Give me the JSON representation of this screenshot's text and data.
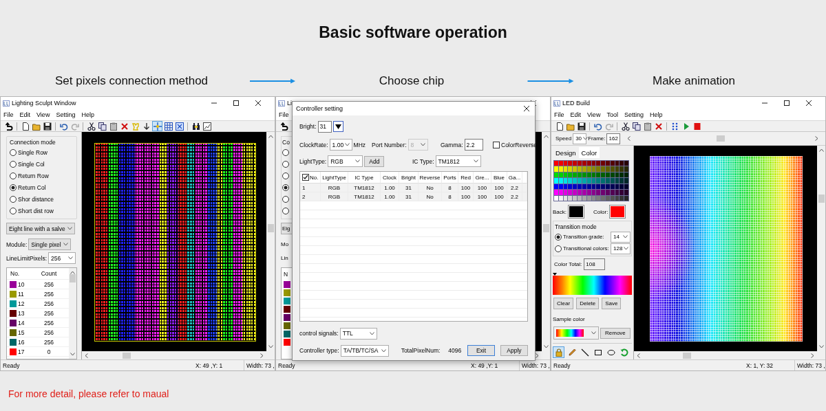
{
  "title": "Basic software operation",
  "steps": [
    {
      "label": "Set pixels connection method"
    },
    {
      "label": "Choose chip"
    },
    {
      "label": "Make animation"
    }
  ],
  "sculpt_window": {
    "title": "Lighting Sculpt Window",
    "menu": [
      "File",
      "Edit",
      "View",
      "Setting",
      "Help"
    ],
    "toolbar": [
      [
        {
          "kind": "back",
          "selected": false
        }
      ],
      [
        {
          "kind": "new",
          "selected": false
        },
        {
          "kind": "open",
          "selected": false
        },
        {
          "kind": "save",
          "selected": false
        }
      ],
      [
        {
          "kind": "undo",
          "selected": false
        },
        {
          "kind": "redo",
          "selected": false
        }
      ],
      [
        {
          "kind": "cut",
          "selected": false
        },
        {
          "kind": "copy",
          "selected": false
        },
        {
          "kind": "paste",
          "selected": false
        },
        {
          "kind": "delete",
          "selected": false
        },
        {
          "kind": "shape",
          "selected": false
        },
        {
          "kind": "down",
          "selected": false
        },
        {
          "kind": "cross",
          "selected": true
        },
        {
          "kind": "grid",
          "selected": false
        },
        {
          "kind": "gridx",
          "selected": false
        }
      ],
      [
        {
          "kind": "find",
          "selected": false
        },
        {
          "kind": "image",
          "selected": false
        }
      ]
    ],
    "connection_mode": {
      "title": "Connection mode",
      "options": [
        {
          "label": "Single Row",
          "selected": false
        },
        {
          "label": "Single Col",
          "selected": false
        },
        {
          "label": "Return Row",
          "selected": false
        },
        {
          "label": "Return Col",
          "selected": true
        },
        {
          "label": "Shor distance",
          "selected": false
        },
        {
          "label": "Short dist row",
          "selected": false
        }
      ]
    },
    "wiring": "Eight line with a salve",
    "module": {
      "label": "Module:",
      "value": "Single pixel"
    },
    "line_limit": {
      "label": "LineLimitPixels:",
      "value": "256"
    },
    "port_list": {
      "columns": [
        "No.",
        "Count"
      ],
      "rows": [
        {
          "no": "10",
          "count": "256",
          "color": "#990099"
        },
        {
          "no": "11",
          "count": "256",
          "color": "#999900"
        },
        {
          "no": "12",
          "count": "256",
          "color": "#009999"
        },
        {
          "no": "13",
          "count": "256",
          "color": "#660000"
        },
        {
          "no": "14",
          "count": "256",
          "color": "#660066"
        },
        {
          "no": "15",
          "count": "256",
          "color": "#666600"
        },
        {
          "no": "16",
          "count": "256",
          "color": "#006666"
        },
        {
          "no": "17",
          "count": "0",
          "color": "#ff0000"
        }
      ]
    },
    "status_bar": {
      "text": "Ready",
      "position": "X: 49 ,Y: 1",
      "size": "Width: 73 ,"
    }
  },
  "chip_window": {
    "title": "Li",
    "menu": [
      "File"
    ],
    "toolbar": [
      [
        {
          "kind": "back",
          "selected": false
        }
      ]
    ],
    "panel": {
      "group_title": "Co",
      "radios": [
        {
          "selected": false
        },
        {
          "selected": false
        },
        {
          "selected": false
        },
        {
          "selected": true
        },
        {
          "selected": false
        },
        {
          "selected": false
        }
      ],
      "wiring": "Eig",
      "module_label": "Mo",
      "line_limit_label": "Lin",
      "list_header": "N",
      "swatches": [
        {
          "color": "#990099"
        },
        {
          "color": "#999900"
        },
        {
          "color": "#009999"
        },
        {
          "color": "#660000"
        },
        {
          "color": "#660066"
        },
        {
          "color": "#666600"
        },
        {
          "color": "#006666"
        },
        {
          "color": "#ff0000"
        }
      ]
    },
    "dialog": {
      "title": "Controller setting",
      "bright": {
        "label": "Bright:",
        "value": "31"
      },
      "clock_rate": {
        "label": "ClockRate:",
        "value": "1.00",
        "unit": "MHz"
      },
      "port_number": {
        "label": "Port Number:",
        "value": "8",
        "disabled": true
      },
      "gamma": {
        "label": "Gamma:",
        "value": "2.2"
      },
      "color_reverse": {
        "label": "ColorReverse",
        "checked": false
      },
      "light_type": {
        "label": "LightType:",
        "value": "RGB"
      },
      "add_button": "Add",
      "ic_type": {
        "label": "IC Type:",
        "value": "TM1812"
      },
      "table": {
        "header_checked": true,
        "columns": [
          "No.",
          "LightType",
          "IC Type",
          "Clock",
          "Bright",
          "Reverse",
          "Ports",
          "Red",
          "Gre...",
          "Blue",
          "Ga..."
        ],
        "rows": [
          [
            "1",
            "RGB",
            "TM1812",
            "1.00",
            "31",
            "No",
            "8",
            "100",
            "100",
            "100",
            "2.2"
          ],
          [
            "2",
            "RGB",
            "TM1812",
            "1.00",
            "31",
            "No",
            "8",
            "100",
            "100",
            "100",
            "2.2"
          ]
        ]
      },
      "control_signals": {
        "label": "control signals:",
        "value": "TTL"
      },
      "controller_type": {
        "label": "Controller type:",
        "value": "TA/TB/TC/SA"
      },
      "total": {
        "label": "TotalPixelNum:",
        "value": "4096"
      },
      "buttons": [
        {
          "label": "Exit",
          "focused": true
        },
        {
          "label": "Apply",
          "focused": false
        }
      ]
    },
    "status_bar": {
      "text": "Ready",
      "position": "X: 49 ,Y: 1",
      "size": "Width: 73 ,"
    }
  },
  "build_window": {
    "title": "LED Build",
    "menu": [
      "File",
      "Edit",
      "View",
      "Tool",
      "Setting",
      "Help"
    ],
    "toolbar": [
      [
        {
          "kind": "new",
          "selected": false
        },
        {
          "kind": "open",
          "selected": false
        },
        {
          "kind": "save",
          "selected": false
        }
      ],
      [
        {
          "kind": "undo",
          "selected": false
        },
        {
          "kind": "redo",
          "selected": false
        }
      ],
      [
        {
          "kind": "cut",
          "selected": false
        },
        {
          "kind": "copy",
          "selected": false
        },
        {
          "kind": "paste",
          "selected": false
        },
        {
          "kind": "delete",
          "selected": false
        }
      ],
      [
        {
          "kind": "dots",
          "selected": false
        },
        {
          "kind": "play",
          "selected": false
        },
        {
          "kind": "stop",
          "selected": false
        }
      ]
    ],
    "speed": {
      "label": "Speed",
      "value": "30"
    },
    "frame": {
      "label": "Frame:",
      "value": "162"
    },
    "tabs": [
      {
        "label": "Design",
        "selected": false
      },
      {
        "label": "Color",
        "selected": true
      }
    ],
    "swatches": [
      {
        "label": "Back:",
        "color": "#000000"
      },
      {
        "label": "Color:",
        "color": "#ff0000"
      }
    ],
    "transition": {
      "title": "Transition mode",
      "options": [
        {
          "label": "Transition grade:",
          "selected": true,
          "value": "14"
        },
        {
          "label": "Transitional colors:",
          "selected": false,
          "value": "128"
        }
      ]
    },
    "color_total": {
      "label": "Color Total:",
      "value": "108"
    },
    "gradient_buttons": [
      "Clear",
      "Delete",
      "Save"
    ],
    "sample_color": {
      "label": "Sample color",
      "button": "Remove"
    },
    "draw_tools": [
      {
        "kind": "lock",
        "selected": true
      },
      {
        "kind": "pencil",
        "selected": false
      },
      {
        "kind": "line",
        "selected": false
      },
      {
        "kind": "rect",
        "selected": false
      },
      {
        "kind": "ellipse",
        "selected": false
      },
      {
        "kind": "fill",
        "selected": false
      }
    ],
    "status_bar": {
      "text": "Ready",
      "position": "X: 1, Y: 32",
      "size": "Width: 73 ,"
    }
  },
  "footer": "For more detail, please refer to maual"
}
